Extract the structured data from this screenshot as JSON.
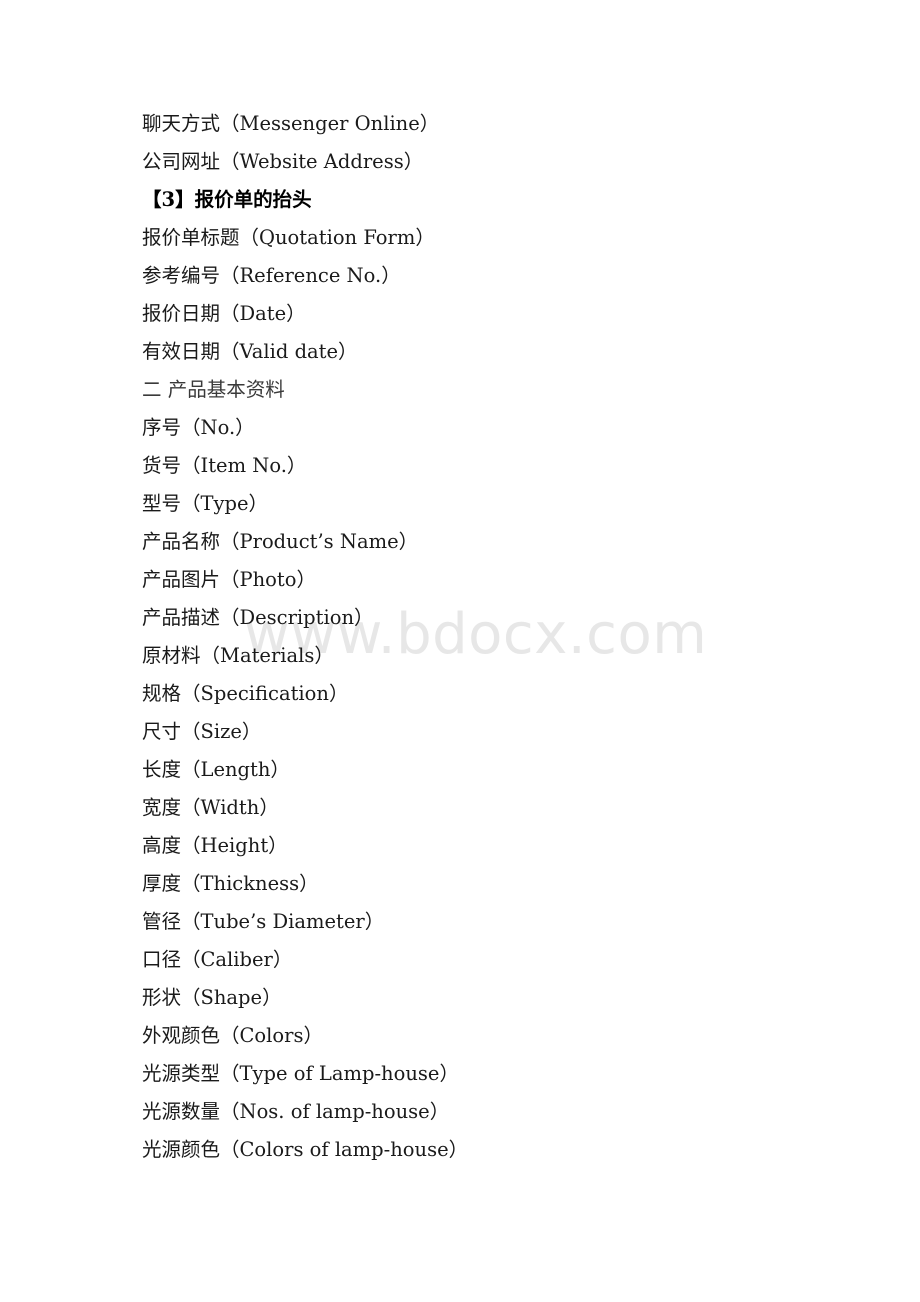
{
  "document": {
    "watermark": "www.bdocx.com",
    "lines": [
      {
        "text": "聊天方式（Messenger Online）",
        "style": "body"
      },
      {
        "text": "公司网址（Website Address）",
        "style": "body"
      },
      {
        "text": "【3】报价单的抬头",
        "style": "heading-bracket"
      },
      {
        "text": "报价单标题（Quotation Form）",
        "style": "body"
      },
      {
        "text": "参考编号（Reference No.）",
        "style": "body"
      },
      {
        "text": "报价日期（Date）",
        "style": "body"
      },
      {
        "text": "有效日期（Valid date）",
        "style": "body"
      },
      {
        "text": "二 产品基本资料",
        "style": "heading-section"
      },
      {
        "text": "序号（No.）",
        "style": "body"
      },
      {
        "text": "货号（Item No.）",
        "style": "body"
      },
      {
        "text": "型号（Type）",
        "style": "body"
      },
      {
        "text": "产品名称（Product’s Name）",
        "style": "body"
      },
      {
        "text": "产品图片（Photo）",
        "style": "body"
      },
      {
        "text": "产品描述（Description）",
        "style": "body"
      },
      {
        "text": "原材料（Materials）",
        "style": "body"
      },
      {
        "text": "规格（Specification）",
        "style": "body"
      },
      {
        "text": "尺寸（Size）",
        "style": "body"
      },
      {
        "text": "长度（Length）",
        "style": "body"
      },
      {
        "text": "宽度（Width）",
        "style": "body"
      },
      {
        "text": "高度（Height）",
        "style": "body"
      },
      {
        "text": "厚度（Thickness）",
        "style": "body"
      },
      {
        "text": "管径（Tube’s Diameter）",
        "style": "body"
      },
      {
        "text": "口径（Caliber）",
        "style": "body"
      },
      {
        "text": "形状（Shape）",
        "style": "body"
      },
      {
        "text": "外观颜色（Colors）",
        "style": "body"
      },
      {
        "text": "光源类型（Type of Lamp-house）",
        "style": "body"
      },
      {
        "text": "光源数量（Nos. of lamp-house）",
        "style": "body"
      },
      {
        "text": "光源颜色（Colors of lamp-house）",
        "style": "body"
      }
    ]
  }
}
